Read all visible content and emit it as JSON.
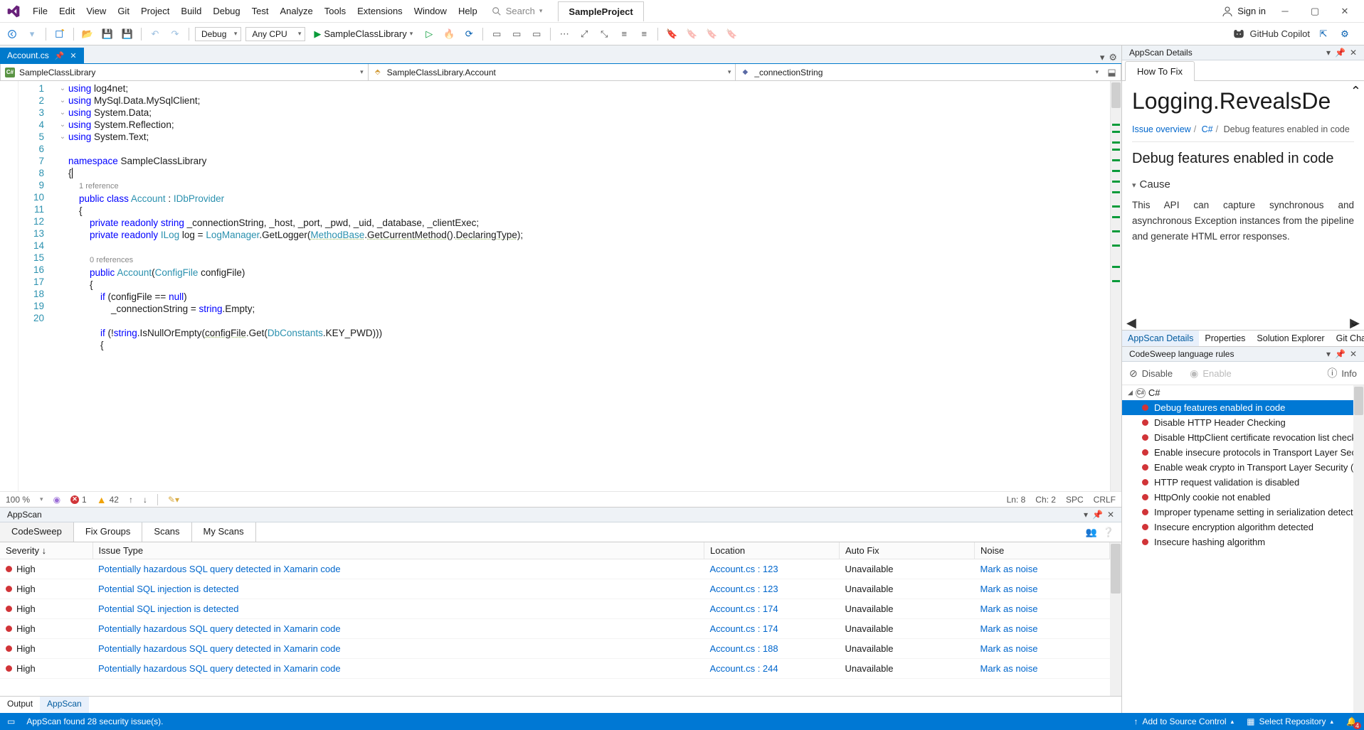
{
  "menu": [
    "File",
    "Edit",
    "View",
    "Git",
    "Project",
    "Build",
    "Debug",
    "Test",
    "Analyze",
    "Tools",
    "Extensions",
    "Window",
    "Help"
  ],
  "search_placeholder": "Search",
  "project_tab": "SampleProject",
  "sign_in": "Sign in",
  "toolbar": {
    "config": "Debug",
    "platform": "Any CPU",
    "start_target": "SampleClassLibrary",
    "copilot": "GitHub Copilot"
  },
  "doc_tab": "Account.cs",
  "nav": {
    "project": "SampleClassLibrary",
    "class": "SampleClassLibrary.Account",
    "member": "_connectionString"
  },
  "code_lines": [
    {
      "n": 1,
      "fold": "v",
      "html": "<span class='kw'>using</span> log4net;"
    },
    {
      "n": 2,
      "fold": "",
      "html": "<span class='kw'>using</span> MySql.Data.MySqlClient;"
    },
    {
      "n": 3,
      "fold": "",
      "html": "<span class='kw'>using</span> System.Data;"
    },
    {
      "n": 4,
      "fold": "",
      "html": "<span class='kw'>using</span> System.Reflection;"
    },
    {
      "n": 5,
      "fold": "",
      "html": "<span class='kw'>using</span> System.Text;"
    },
    {
      "n": 6,
      "fold": "",
      "html": ""
    },
    {
      "n": 7,
      "fold": "v",
      "html": "<span class='kw'>namespace</span> SampleClassLibrary"
    },
    {
      "n": 8,
      "fold": "",
      "html": "{<span class='cur'></span>"
    },
    {
      "n": 0,
      "fold": "",
      "html": "    <span class='cl'>1 reference</span>"
    },
    {
      "n": 9,
      "fold": "v",
      "html": "    <span class='kw'>public</span> <span class='kw'>class</span> <span class='type'>Account</span> : <span class='type'>IDbProvider</span>"
    },
    {
      "n": 10,
      "fold": "",
      "html": "    {"
    },
    {
      "n": 11,
      "fold": "",
      "html": "        <span class='kw'>private</span> <span class='kw'>readonly</span> <span class='kw'>string</span> _connectionString, _host, _port, _pwd, _uid, _database, _clientExec;"
    },
    {
      "n": 12,
      "fold": "",
      "html": "        <span class='kw'>private</span> <span class='kw'>readonly</span> <span class='type'>ILog</span> log = <span class='type'>LogManager</span>.GetLogger(<span class='type und'>MethodBase</span>.<span class='und'>GetCurrentMethod</span>().<span class='und'>DeclaringType</span>);"
    },
    {
      "n": 13,
      "fold": "",
      "html": ""
    },
    {
      "n": 0,
      "fold": "",
      "html": "        <span class='cl'>0 references</span>"
    },
    {
      "n": 14,
      "fold": "v",
      "html": "        <span class='kw'>public</span> <span class='type'>Account</span>(<span class='type'>ConfigFile</span> configFile)"
    },
    {
      "n": 15,
      "fold": "",
      "html": "        {"
    },
    {
      "n": 16,
      "fold": "",
      "html": "            <span class='kw'>if</span> (configFile == <span class='kw'>null</span>)"
    },
    {
      "n": 17,
      "fold": "",
      "html": "                _connectionString = <span class='kw'>string</span>.Empty;"
    },
    {
      "n": 18,
      "fold": "",
      "html": ""
    },
    {
      "n": 19,
      "fold": "v",
      "html": "            <span class='kw'>if</span> (!<span class='kw'>string</span>.IsNullOrEmpty(<span class='und'>configFile</span>.Get(<span class='type'>DbConstants</span>.KEY_PWD)))"
    },
    {
      "n": 20,
      "fold": "",
      "html": "            {"
    }
  ],
  "editor_status": {
    "zoom": "100 %",
    "errors": "1",
    "warnings": "42",
    "line": "Ln: 8",
    "col": "Ch: 2",
    "ins": "SPC",
    "eol": "CRLF"
  },
  "appscan": {
    "panel_title": "AppScan",
    "tabs": [
      "CodeSweep",
      "Fix Groups",
      "Scans",
      "My Scans"
    ],
    "columns": [
      "Severity ↓",
      "Issue Type",
      "Location",
      "Auto Fix",
      "Noise"
    ],
    "rows": [
      {
        "sev": "High",
        "issue": "Potentially hazardous SQL query detected in Xamarin code",
        "loc": "Account.cs : 123",
        "fix": "Unavailable",
        "noise": "Mark as noise"
      },
      {
        "sev": "High",
        "issue": "Potential SQL injection is detected",
        "loc": "Account.cs : 123",
        "fix": "Unavailable",
        "noise": "Mark as noise"
      },
      {
        "sev": "High",
        "issue": "Potential SQL injection is detected",
        "loc": "Account.cs : 174",
        "fix": "Unavailable",
        "noise": "Mark as noise"
      },
      {
        "sev": "High",
        "issue": "Potentially hazardous SQL query detected in Xamarin code",
        "loc": "Account.cs : 174",
        "fix": "Unavailable",
        "noise": "Mark as noise"
      },
      {
        "sev": "High",
        "issue": "Potentially hazardous SQL query detected in Xamarin code",
        "loc": "Account.cs : 188",
        "fix": "Unavailable",
        "noise": "Mark as noise"
      },
      {
        "sev": "High",
        "issue": "Potentially hazardous SQL query detected in Xamarin code",
        "loc": "Account.cs : 244",
        "fix": "Unavailable",
        "noise": "Mark as noise"
      }
    ],
    "footer_tabs": [
      "Output",
      "AppScan"
    ]
  },
  "details": {
    "panel_title": "AppScan Details",
    "how_tab": "How To Fix",
    "heading_clipped": "Logging.RevealsDe",
    "breadcrumb": [
      "Issue overview",
      "C#",
      "Debug features enabled in code"
    ],
    "h2": "Debug features enabled in code",
    "section": "Cause",
    "body": "This API can capture synchronous and asynchronous Exception instances from the pipeline and generate HTML error responses.",
    "tabs": [
      "AppScan Details",
      "Properties",
      "Solution Explorer",
      "Git Changes"
    ]
  },
  "rules": {
    "panel_title": "CodeSweep language rules",
    "toolbar": {
      "disable": "Disable",
      "enable": "Enable",
      "info": "Info"
    },
    "language": "C#",
    "items": [
      "Debug features enabled in code",
      "Disable HTTP Header Checking",
      "Disable HttpClient certificate revocation list check",
      "Enable insecure protocols in Transport Layer Security",
      "Enable weak crypto in Transport Layer Security (TLS)",
      "HTTP request validation is disabled",
      "HttpOnly cookie not enabled",
      "Improper typename setting in serialization detected",
      "Insecure encryption algorithm detected",
      "Insecure hashing algorithm"
    ]
  },
  "statusbar": {
    "msg": "AppScan found 28 security issue(s).",
    "add_source": "Add to Source Control",
    "select_repo": "Select Repository",
    "notif": "4"
  }
}
